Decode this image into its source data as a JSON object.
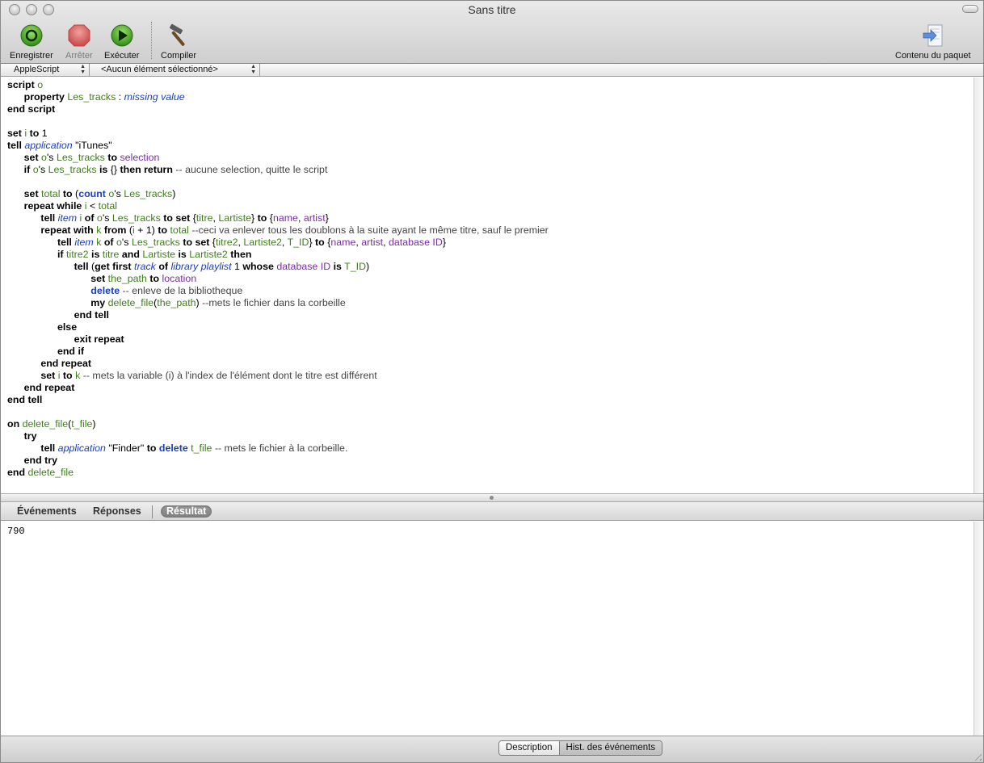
{
  "window": {
    "title": "Sans titre"
  },
  "toolbar": {
    "record": "Enregistrer",
    "stop": "Arrêter",
    "run": "Exécuter",
    "compile": "Compiler",
    "bundle": "Contenu du paquet"
  },
  "navbar": {
    "language": "AppleScript",
    "element": "<Aucun élément sélectionné>"
  },
  "script_lines": [
    [
      [
        "kw",
        "script"
      ],
      [
        "t",
        " "
      ],
      [
        "var",
        "o"
      ]
    ],
    [
      [
        "t",
        "      "
      ],
      [
        "kw",
        "property"
      ],
      [
        "t",
        " "
      ],
      [
        "var",
        "Les_tracks"
      ],
      [
        "t",
        " : "
      ],
      [
        "app",
        "missing value"
      ]
    ],
    [
      [
        "kw",
        "end script"
      ]
    ],
    [],
    [
      [
        "kw",
        "set"
      ],
      [
        "t",
        " "
      ],
      [
        "var",
        "i"
      ],
      [
        "t",
        " "
      ],
      [
        "kw",
        "to"
      ],
      [
        "t",
        " "
      ],
      [
        "num",
        "1"
      ]
    ],
    [
      [
        "kw",
        "tell"
      ],
      [
        "t",
        " "
      ],
      [
        "app",
        "application"
      ],
      [
        "t",
        " "
      ],
      [
        "str",
        "\"iTunes\""
      ]
    ],
    [
      [
        "t",
        "      "
      ],
      [
        "kw",
        "set"
      ],
      [
        "t",
        " "
      ],
      [
        "var",
        "o"
      ],
      [
        "t",
        "'s "
      ],
      [
        "var",
        "Les_tracks"
      ],
      [
        "t",
        " "
      ],
      [
        "kw",
        "to"
      ],
      [
        "t",
        " "
      ],
      [
        "prop",
        "selection"
      ]
    ],
    [
      [
        "t",
        "      "
      ],
      [
        "kw",
        "if"
      ],
      [
        "t",
        " "
      ],
      [
        "var",
        "o"
      ],
      [
        "t",
        "'s "
      ],
      [
        "var",
        "Les_tracks"
      ],
      [
        "t",
        " "
      ],
      [
        "kw",
        "is"
      ],
      [
        "t",
        " {} "
      ],
      [
        "kw",
        "then"
      ],
      [
        "t",
        " "
      ],
      [
        "kw",
        "return"
      ],
      [
        "t",
        " "
      ],
      [
        "cmt",
        "-- aucune selection, quitte le script"
      ]
    ],
    [],
    [
      [
        "t",
        "      "
      ],
      [
        "kw",
        "set"
      ],
      [
        "t",
        " "
      ],
      [
        "var",
        "total"
      ],
      [
        "t",
        " "
      ],
      [
        "kw",
        "to"
      ],
      [
        "t",
        " ("
      ],
      [
        "cmd",
        "count"
      ],
      [
        "t",
        " "
      ],
      [
        "var",
        "o"
      ],
      [
        "t",
        "'s "
      ],
      [
        "var",
        "Les_tracks"
      ],
      [
        "t",
        ")"
      ]
    ],
    [
      [
        "t",
        "      "
      ],
      [
        "kw",
        "repeat while"
      ],
      [
        "t",
        " "
      ],
      [
        "var",
        "i"
      ],
      [
        "t",
        " < "
      ],
      [
        "var",
        "total"
      ]
    ],
    [
      [
        "t",
        "            "
      ],
      [
        "kw",
        "tell"
      ],
      [
        "t",
        " "
      ],
      [
        "app",
        "item"
      ],
      [
        "t",
        " "
      ],
      [
        "var",
        "i"
      ],
      [
        "t",
        " "
      ],
      [
        "kw",
        "of"
      ],
      [
        "t",
        " "
      ],
      [
        "var",
        "o"
      ],
      [
        "t",
        "'s "
      ],
      [
        "var",
        "Les_tracks"
      ],
      [
        "t",
        " "
      ],
      [
        "kw",
        "to set"
      ],
      [
        "t",
        " {"
      ],
      [
        "var",
        "titre"
      ],
      [
        "t",
        ", "
      ],
      [
        "var",
        "Lartiste"
      ],
      [
        "t",
        "} "
      ],
      [
        "kw",
        "to"
      ],
      [
        "t",
        " {"
      ],
      [
        "prop",
        "name"
      ],
      [
        "t",
        ", "
      ],
      [
        "prop",
        "artist"
      ],
      [
        "t",
        "}"
      ]
    ],
    [
      [
        "t",
        "            "
      ],
      [
        "kw",
        "repeat with"
      ],
      [
        "t",
        " "
      ],
      [
        "var",
        "k"
      ],
      [
        "t",
        " "
      ],
      [
        "kw",
        "from"
      ],
      [
        "t",
        " ("
      ],
      [
        "var",
        "i"
      ],
      [
        "t",
        " + 1) "
      ],
      [
        "kw",
        "to"
      ],
      [
        "t",
        " "
      ],
      [
        "var",
        "total"
      ],
      [
        "t",
        " "
      ],
      [
        "cmt",
        "--ceci va enlever tous les doublons à la suite ayant le même titre, sauf le premier"
      ]
    ],
    [
      [
        "t",
        "                  "
      ],
      [
        "kw",
        "tell"
      ],
      [
        "t",
        " "
      ],
      [
        "app",
        "item"
      ],
      [
        "t",
        " "
      ],
      [
        "var",
        "k"
      ],
      [
        "t",
        " "
      ],
      [
        "kw",
        "of"
      ],
      [
        "t",
        " "
      ],
      [
        "var",
        "o"
      ],
      [
        "t",
        "'s "
      ],
      [
        "var",
        "Les_tracks"
      ],
      [
        "t",
        " "
      ],
      [
        "kw",
        "to set"
      ],
      [
        "t",
        " {"
      ],
      [
        "var",
        "titre2"
      ],
      [
        "t",
        ", "
      ],
      [
        "var",
        "Lartiste2"
      ],
      [
        "t",
        ", "
      ],
      [
        "var",
        "T_ID"
      ],
      [
        "t",
        "} "
      ],
      [
        "kw",
        "to"
      ],
      [
        "t",
        " {"
      ],
      [
        "prop",
        "name"
      ],
      [
        "t",
        ", "
      ],
      [
        "prop",
        "artist"
      ],
      [
        "t",
        ", "
      ],
      [
        "prop",
        "database ID"
      ],
      [
        "t",
        "}"
      ]
    ],
    [
      [
        "t",
        "                  "
      ],
      [
        "kw",
        "if"
      ],
      [
        "t",
        " "
      ],
      [
        "var",
        "titre2"
      ],
      [
        "t",
        " "
      ],
      [
        "kw",
        "is"
      ],
      [
        "t",
        " "
      ],
      [
        "var",
        "titre"
      ],
      [
        "t",
        " "
      ],
      [
        "kw",
        "and"
      ],
      [
        "t",
        " "
      ],
      [
        "var",
        "Lartiste"
      ],
      [
        "t",
        " "
      ],
      [
        "kw",
        "is"
      ],
      [
        "t",
        " "
      ],
      [
        "var",
        "Lartiste2"
      ],
      [
        "t",
        " "
      ],
      [
        "kw",
        "then"
      ]
    ],
    [
      [
        "t",
        "                        "
      ],
      [
        "kw",
        "tell"
      ],
      [
        "t",
        " ("
      ],
      [
        "kw",
        "get first"
      ],
      [
        "t",
        " "
      ],
      [
        "app",
        "track"
      ],
      [
        "t",
        " "
      ],
      [
        "kw",
        "of"
      ],
      [
        "t",
        " "
      ],
      [
        "app",
        "library playlist"
      ],
      [
        "t",
        " 1 "
      ],
      [
        "kw",
        "whose"
      ],
      [
        "t",
        " "
      ],
      [
        "prop",
        "database ID"
      ],
      [
        "t",
        " "
      ],
      [
        "kw",
        "is"
      ],
      [
        "t",
        " "
      ],
      [
        "var",
        "T_ID"
      ],
      [
        "t",
        ")"
      ]
    ],
    [
      [
        "t",
        "                              "
      ],
      [
        "kw",
        "set"
      ],
      [
        "t",
        " "
      ],
      [
        "var",
        "the_path"
      ],
      [
        "t",
        " "
      ],
      [
        "kw",
        "to"
      ],
      [
        "t",
        " "
      ],
      [
        "prop",
        "location"
      ]
    ],
    [
      [
        "t",
        "                              "
      ],
      [
        "cmd",
        "delete"
      ],
      [
        "t",
        " "
      ],
      [
        "cmt",
        "-- enleve de la bibliotheque"
      ]
    ],
    [
      [
        "t",
        "                              "
      ],
      [
        "kw",
        "my"
      ],
      [
        "t",
        " "
      ],
      [
        "var",
        "delete_file"
      ],
      [
        "t",
        "("
      ],
      [
        "var",
        "the_path"
      ],
      [
        "t",
        ") "
      ],
      [
        "cmt",
        "--mets le fichier dans la corbeille"
      ]
    ],
    [
      [
        "t",
        "                        "
      ],
      [
        "kw",
        "end tell"
      ]
    ],
    [
      [
        "t",
        "                  "
      ],
      [
        "kw",
        "else"
      ]
    ],
    [
      [
        "t",
        "                        "
      ],
      [
        "kw",
        "exit repeat"
      ]
    ],
    [
      [
        "t",
        "                  "
      ],
      [
        "kw",
        "end if"
      ]
    ],
    [
      [
        "t",
        "            "
      ],
      [
        "kw",
        "end repeat"
      ]
    ],
    [
      [
        "t",
        "            "
      ],
      [
        "kw",
        "set"
      ],
      [
        "t",
        " "
      ],
      [
        "var",
        "i"
      ],
      [
        "t",
        " "
      ],
      [
        "kw",
        "to"
      ],
      [
        "t",
        " "
      ],
      [
        "var",
        "k"
      ],
      [
        "t",
        " "
      ],
      [
        "cmt",
        "-- mets la variable (i) à l'index de l'élément dont le titre est différent"
      ]
    ],
    [
      [
        "t",
        "      "
      ],
      [
        "kw",
        "end repeat"
      ]
    ],
    [
      [
        "kw",
        "end tell"
      ]
    ],
    [],
    [
      [
        "kw",
        "on"
      ],
      [
        "t",
        " "
      ],
      [
        "var",
        "delete_file"
      ],
      [
        "t",
        "("
      ],
      [
        "var",
        "t_file"
      ],
      [
        "t",
        ")"
      ]
    ],
    [
      [
        "t",
        "      "
      ],
      [
        "kw",
        "try"
      ]
    ],
    [
      [
        "t",
        "            "
      ],
      [
        "kw",
        "tell"
      ],
      [
        "t",
        " "
      ],
      [
        "app",
        "application"
      ],
      [
        "t",
        " "
      ],
      [
        "str",
        "\"Finder\""
      ],
      [
        "t",
        " "
      ],
      [
        "kw",
        "to"
      ],
      [
        "t",
        " "
      ],
      [
        "cmd",
        "delete"
      ],
      [
        "t",
        " "
      ],
      [
        "var",
        "t_file"
      ],
      [
        "t",
        " "
      ],
      [
        "cmt",
        "-- mets le fichier à la corbeille."
      ]
    ],
    [
      [
        "t",
        "      "
      ],
      [
        "kw",
        "end try"
      ]
    ],
    [
      [
        "kw",
        "end"
      ],
      [
        "t",
        " "
      ],
      [
        "var",
        "delete_file"
      ]
    ]
  ],
  "result_tabs": {
    "events": "Événements",
    "replies": "Réponses",
    "result": "Résultat"
  },
  "result": {
    "value": "790"
  },
  "bottom": {
    "description": "Description",
    "history": "Hist. des événements"
  },
  "icons": {
    "record": "record-icon",
    "stop": "stop-icon",
    "run": "run-icon",
    "compile": "hammer-icon",
    "bundle": "bundle-contents-icon"
  },
  "colors": {
    "keyword": "#000000",
    "variable": "#3f7e1a",
    "application_class": "#1b3fba",
    "property": "#7a2ca4",
    "command": "#1b3fba"
  }
}
